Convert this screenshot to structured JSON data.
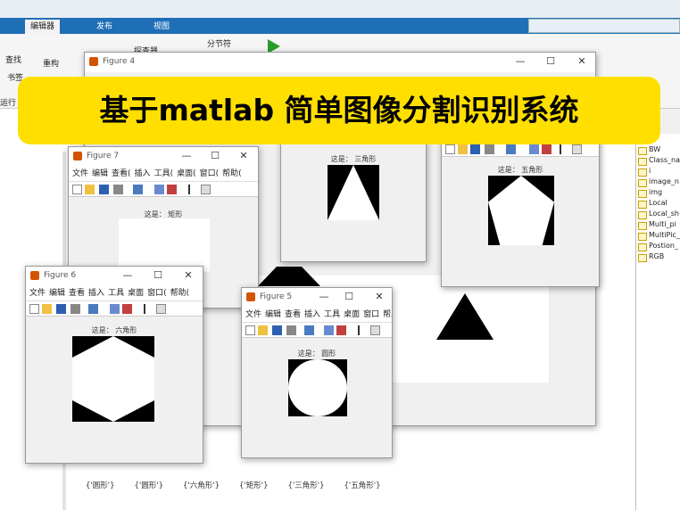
{
  "banner": {
    "title": "基于matlab  简单图像分割识别系统"
  },
  "ribbon": {
    "tabs": [
      "编辑器",
      "发布",
      "视图"
    ],
    "items": {
      "refactor": "重构",
      "find": "查找",
      "bookmark": "书签",
      "run": "运行",
      "analyzer": "探查器",
      "section_break": "分节符"
    }
  },
  "figures": {
    "fig4": {
      "title": "Figure 4"
    },
    "fig7": {
      "title": "Figure 7",
      "menu": [
        "文件",
        "编辑",
        "查看(",
        "插入",
        "工具(",
        "桌面(",
        "窗口(",
        "帮助("
      ],
      "caption": "这是：  矩形"
    },
    "fig_tri": {
      "caption": "这是：  三角形"
    },
    "fig_pent": {
      "caption": "这是：  五角形"
    },
    "fig6": {
      "title": "Figure 6",
      "menu": [
        "文件",
        "编辑",
        "查看",
        "插入",
        "工具",
        "桌面",
        "窗口(",
        "帮助("
      ],
      "caption": "这是：  六角形"
    },
    "fig5": {
      "title": "Figure 5",
      "menu": [
        "文件",
        "编辑",
        "查看",
        "插入",
        "工具",
        "桌面",
        "窗口",
        "帮助"
      ],
      "caption": "这是：  圆形"
    }
  },
  "workspace": {
    "vars": [
      "BW",
      "Class_na",
      "i",
      "image_n",
      "img",
      "Local",
      "Local_sh",
      "Multi_pi",
      "MultiPic_",
      "Postion_",
      "RGB"
    ]
  },
  "command_window": {
    "result": [
      "{'圆形'}",
      "{'圆形'}",
      "{'六角形'}",
      "{'矩形'}",
      "{'三角形'}",
      "{'五角形'}"
    ]
  },
  "colors": {
    "ribbon_blue": "#1f6fb7",
    "banner_yellow": "#ffdf00"
  }
}
